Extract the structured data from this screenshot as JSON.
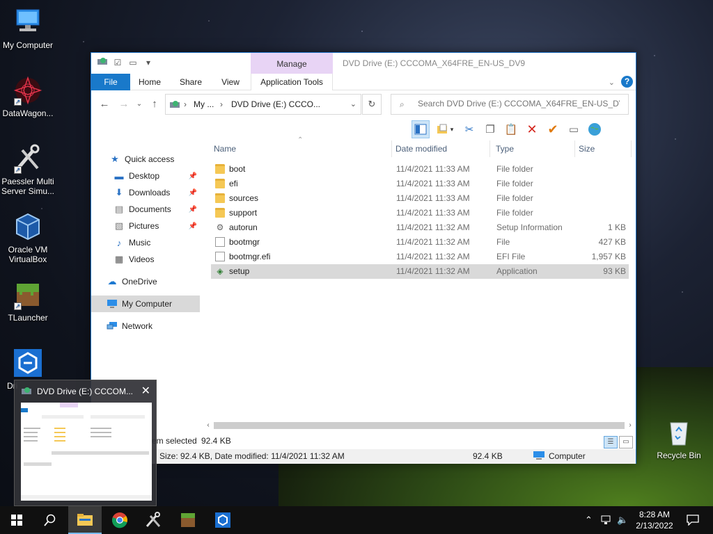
{
  "desktop": {
    "icons": [
      {
        "label": "My Computer",
        "icon": "computer-icon"
      },
      {
        "label": "DataWagon...",
        "icon": "datawagon-icon"
      },
      {
        "label": "Paessler Multi Server Simu...",
        "icon": "tools-icon"
      },
      {
        "label": "Oracle VM VirtualBox",
        "icon": "virtualbox-icon"
      },
      {
        "label": "TLauncher",
        "icon": "grass-block-icon"
      },
      {
        "label": "Dri",
        "icon": "app-icon"
      }
    ],
    "recycle_bin": "Recycle Bin"
  },
  "window": {
    "title": "DVD Drive (E:) CCCOMA_X64FRE_EN-US_DV9",
    "context_tab": "Manage",
    "ribbon_tabs": [
      "File",
      "Home",
      "Share",
      "View",
      "Application Tools"
    ],
    "address": {
      "seg1": "My ...",
      "seg2": "DVD Drive (E:) CCCO..."
    },
    "search_placeholder": "Search DVD Drive (E:) CCCOMA_X64FRE_EN-US_DV9"
  },
  "nav": {
    "quick_access": "Quick access",
    "items": [
      {
        "label": "Desktop",
        "icon": "desktop-icon",
        "pinned": true
      },
      {
        "label": "Downloads",
        "icon": "download-icon",
        "pinned": true
      },
      {
        "label": "Documents",
        "icon": "documents-icon",
        "pinned": true
      },
      {
        "label": "Pictures",
        "icon": "pictures-icon",
        "pinned": true
      },
      {
        "label": "Music",
        "icon": "music-icon",
        "pinned": false
      },
      {
        "label": "Videos",
        "icon": "videos-icon",
        "pinned": false
      }
    ],
    "onedrive": "OneDrive",
    "my_computer": "My Computer",
    "network": "Network"
  },
  "columns": {
    "name": "Name",
    "date": "Date modified",
    "type": "Type",
    "size": "Size"
  },
  "files": [
    {
      "name": "boot",
      "date": "11/4/2021 11:33 AM",
      "type": "File folder",
      "size": "",
      "kind": "folder"
    },
    {
      "name": "efi",
      "date": "11/4/2021 11:33 AM",
      "type": "File folder",
      "size": "",
      "kind": "folder"
    },
    {
      "name": "sources",
      "date": "11/4/2021 11:33 AM",
      "type": "File folder",
      "size": "",
      "kind": "folder"
    },
    {
      "name": "support",
      "date": "11/4/2021 11:33 AM",
      "type": "File folder",
      "size": "",
      "kind": "folder"
    },
    {
      "name": "autorun",
      "date": "11/4/2021 11:32 AM",
      "type": "Setup Information",
      "size": "1 KB",
      "kind": "inf"
    },
    {
      "name": "bootmgr",
      "date": "11/4/2021 11:32 AM",
      "type": "File",
      "size": "427 KB",
      "kind": "file"
    },
    {
      "name": "bootmgr.efi",
      "date": "11/4/2021 11:32 AM",
      "type": "EFI File",
      "size": "1,957 KB",
      "kind": "file"
    },
    {
      "name": "setup",
      "date": "11/4/2021 11:32 AM",
      "type": "Application",
      "size": "93 KB",
      "kind": "app",
      "selected": true
    }
  ],
  "status": {
    "selection": "em selected",
    "selection_size": "92.4 KB",
    "details": "Size: 92.4 KB, Date modified: 11/4/2021 11:32 AM",
    "details_size": "92.4 KB",
    "location": "Computer"
  },
  "preview": {
    "title": "DVD Drive (E:) CCCOM..."
  },
  "taskbar": {
    "apps": [
      "file-explorer-icon",
      "chrome-icon",
      "tools-icon",
      "grass-block-icon",
      "app-icon"
    ],
    "time": "8:28 AM",
    "date": "2/13/2022"
  }
}
